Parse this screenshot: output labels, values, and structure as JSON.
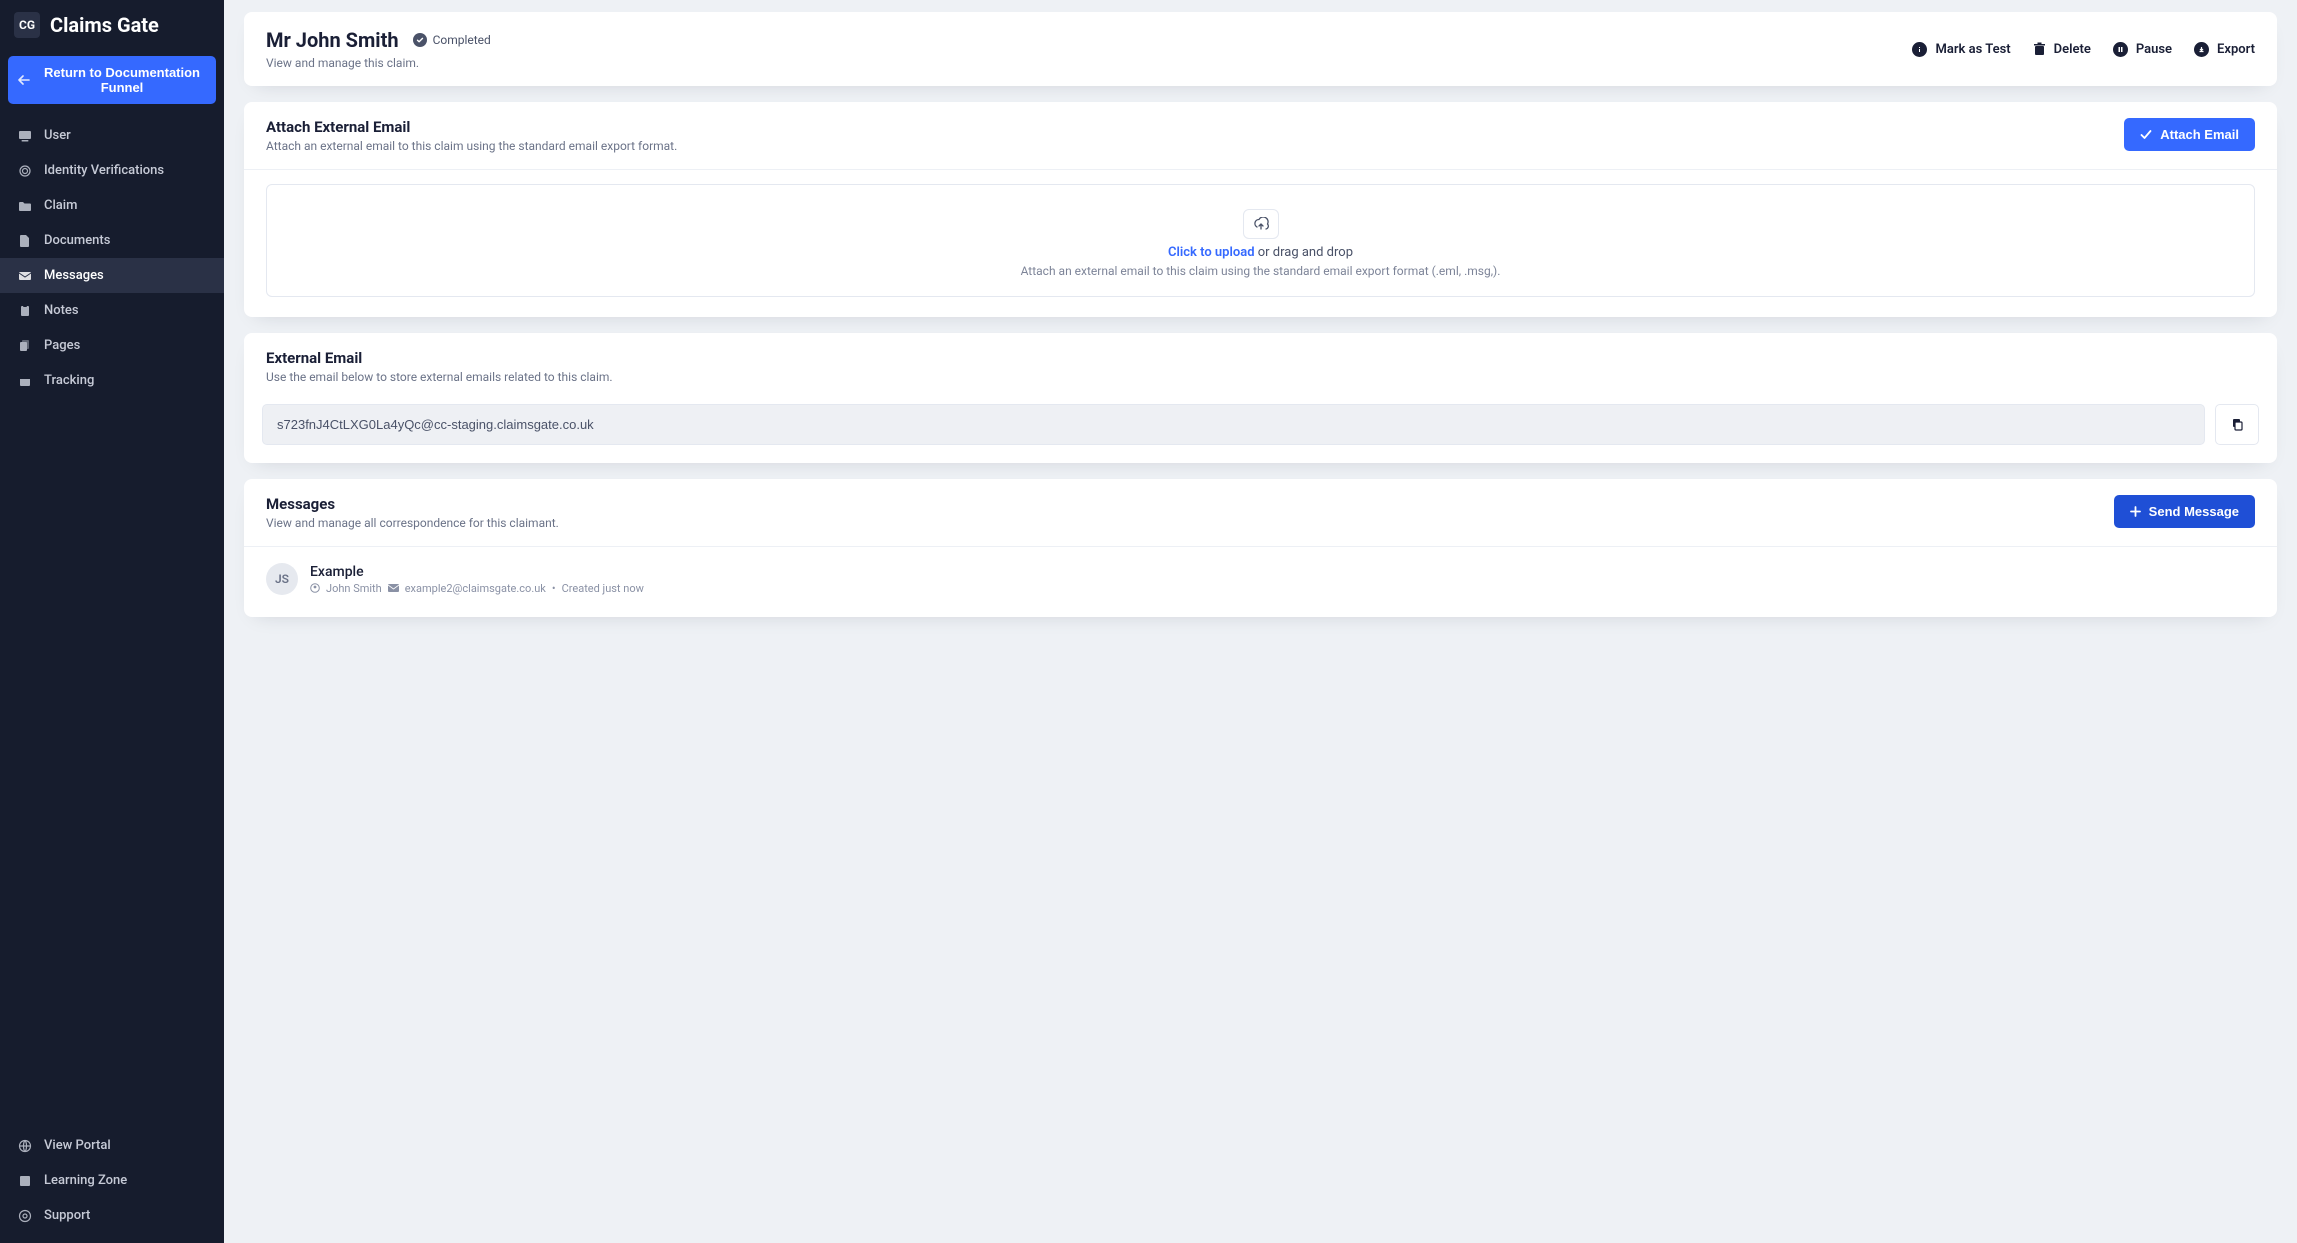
{
  "brand": {
    "name": "Claims Gate",
    "logo": "CG"
  },
  "return_button": "Return to Documentation Funnel",
  "sidebar": {
    "items": [
      {
        "label": "User"
      },
      {
        "label": "Identity Verifications"
      },
      {
        "label": "Claim"
      },
      {
        "label": "Documents"
      },
      {
        "label": "Messages"
      },
      {
        "label": "Notes"
      },
      {
        "label": "Pages"
      },
      {
        "label": "Tracking"
      }
    ],
    "bottom": [
      {
        "label": "View Portal"
      },
      {
        "label": "Learning Zone"
      },
      {
        "label": "Support"
      }
    ]
  },
  "header": {
    "title": "Mr John Smith",
    "status": "Completed",
    "subtitle": "View and manage this claim.",
    "actions": {
      "mark_test": "Mark as Test",
      "delete": "Delete",
      "pause": "Pause",
      "export": "Export"
    }
  },
  "attach": {
    "title": "Attach External Email",
    "subtitle": "Attach an external email to this claim using the standard email export format.",
    "button": "Attach Email",
    "upload_link": "Click to upload",
    "upload_rest": " or drag and drop",
    "upload_sub": "Attach an external email to this claim using the standard email export format (.eml, .msg,)."
  },
  "external": {
    "title": "External Email",
    "subtitle": "Use the email below to store external emails related to this claim.",
    "value": "s723fnJ4CtLXG0La4yQc@cc-staging.claimsgate.co.uk"
  },
  "messages": {
    "title": "Messages",
    "subtitle": "View and manage all correspondence for this claimant.",
    "button": "Send Message",
    "items": [
      {
        "avatar": "JS",
        "title": "Example",
        "author": "John Smith",
        "email": "example2@claimsgate.co.uk",
        "time": "Created just now"
      }
    ]
  }
}
